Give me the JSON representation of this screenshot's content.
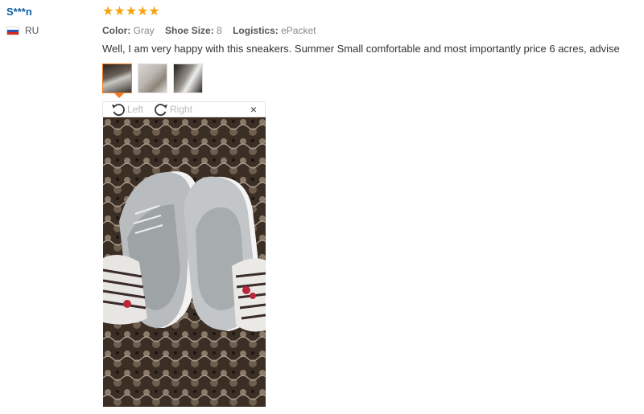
{
  "reviewer": {
    "name": "S***n",
    "country": "RU",
    "flag_icon": "russia-flag-icon"
  },
  "rating": {
    "stars": "★★★★★",
    "value": 5,
    "color": "#f7a20f"
  },
  "attributes": [
    {
      "label": "Color:",
      "value": "Gray"
    },
    {
      "label": "Shoe Size:",
      "value": "8"
    },
    {
      "label": "Logistics:",
      "value": "ePacket"
    }
  ],
  "feedback": "Well, I am very happy with this sneakers. Summer Small comfortable and most importantly price 6 acres, advise",
  "viewer": {
    "rotate_left": "Left",
    "rotate_right": "Right",
    "close": "×"
  },
  "accent_color": "#f47a20"
}
